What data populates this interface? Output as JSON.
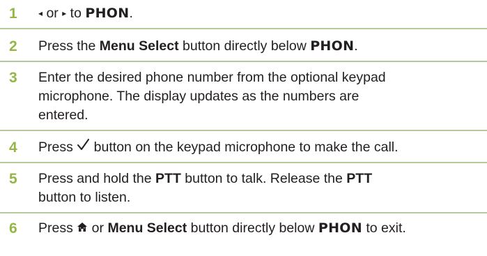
{
  "steps": [
    {
      "number": "1",
      "left_arrow": "◂",
      "or": " or ",
      "right_arrow": "▸",
      "to": " to ",
      "phon": "PHON",
      "end": "."
    },
    {
      "number": "2",
      "press": "Press the ",
      "menu_select": "Menu Select",
      "mid": " button directly below ",
      "phon": "PHON",
      "end": "."
    },
    {
      "number": "3",
      "line1": "Enter the desired phone number from the optional keypad",
      "line2": "microphone. The display updates as the numbers are",
      "line3": "entered."
    },
    {
      "number": "4",
      "press": "Press ",
      "rest": " button on the keypad microphone to make the call."
    },
    {
      "number": "5",
      "press": "Press and hold the ",
      "ptt1": "PTT",
      "mid": " button to talk. Release the ",
      "ptt2": "PTT",
      "line2": "button to listen."
    },
    {
      "number": "6",
      "press": "Press ",
      "or": " or ",
      "menu_select": "Menu Select",
      "mid": " button directly below ",
      "phon": "PHON",
      "end": " to exit."
    }
  ],
  "colors": {
    "step_number": "#95b547",
    "rule": "#b7c99a",
    "text": "#231f20"
  },
  "icons": [
    "left-arrow-icon",
    "right-arrow-icon",
    "checkmark-icon",
    "home-icon"
  ]
}
